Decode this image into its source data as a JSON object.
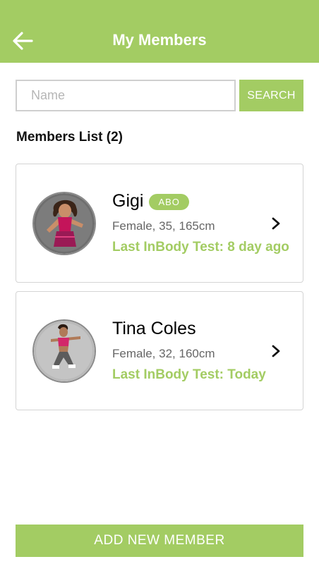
{
  "header": {
    "title": "My Members",
    "back_icon": "arrow-left-icon",
    "background_color": "#a3cc63"
  },
  "search": {
    "placeholder": "Name",
    "value": "",
    "button_label": "SEARCH"
  },
  "members_list": {
    "title": "Members List (2)",
    "members": [
      {
        "name": "Gigi",
        "badge": "ABO",
        "details": "Female, 35, 165cm",
        "last_test": "Last InBody Test: 8 day ago",
        "avatar": "member-photo",
        "chevron": "chevron-right-icon"
      },
      {
        "name": "Tina Coles",
        "details": "Female, 32, 160cm",
        "last_test": "Last InBody Test: Today",
        "avatar": "member-photo",
        "chevron": "chevron-right-icon"
      }
    ]
  },
  "footer": {
    "add_button_label": "ADD NEW MEMBER"
  },
  "colors": {
    "accent": "#a3cc63",
    "text_secondary": "#666666",
    "border": "#d4d4d4"
  }
}
